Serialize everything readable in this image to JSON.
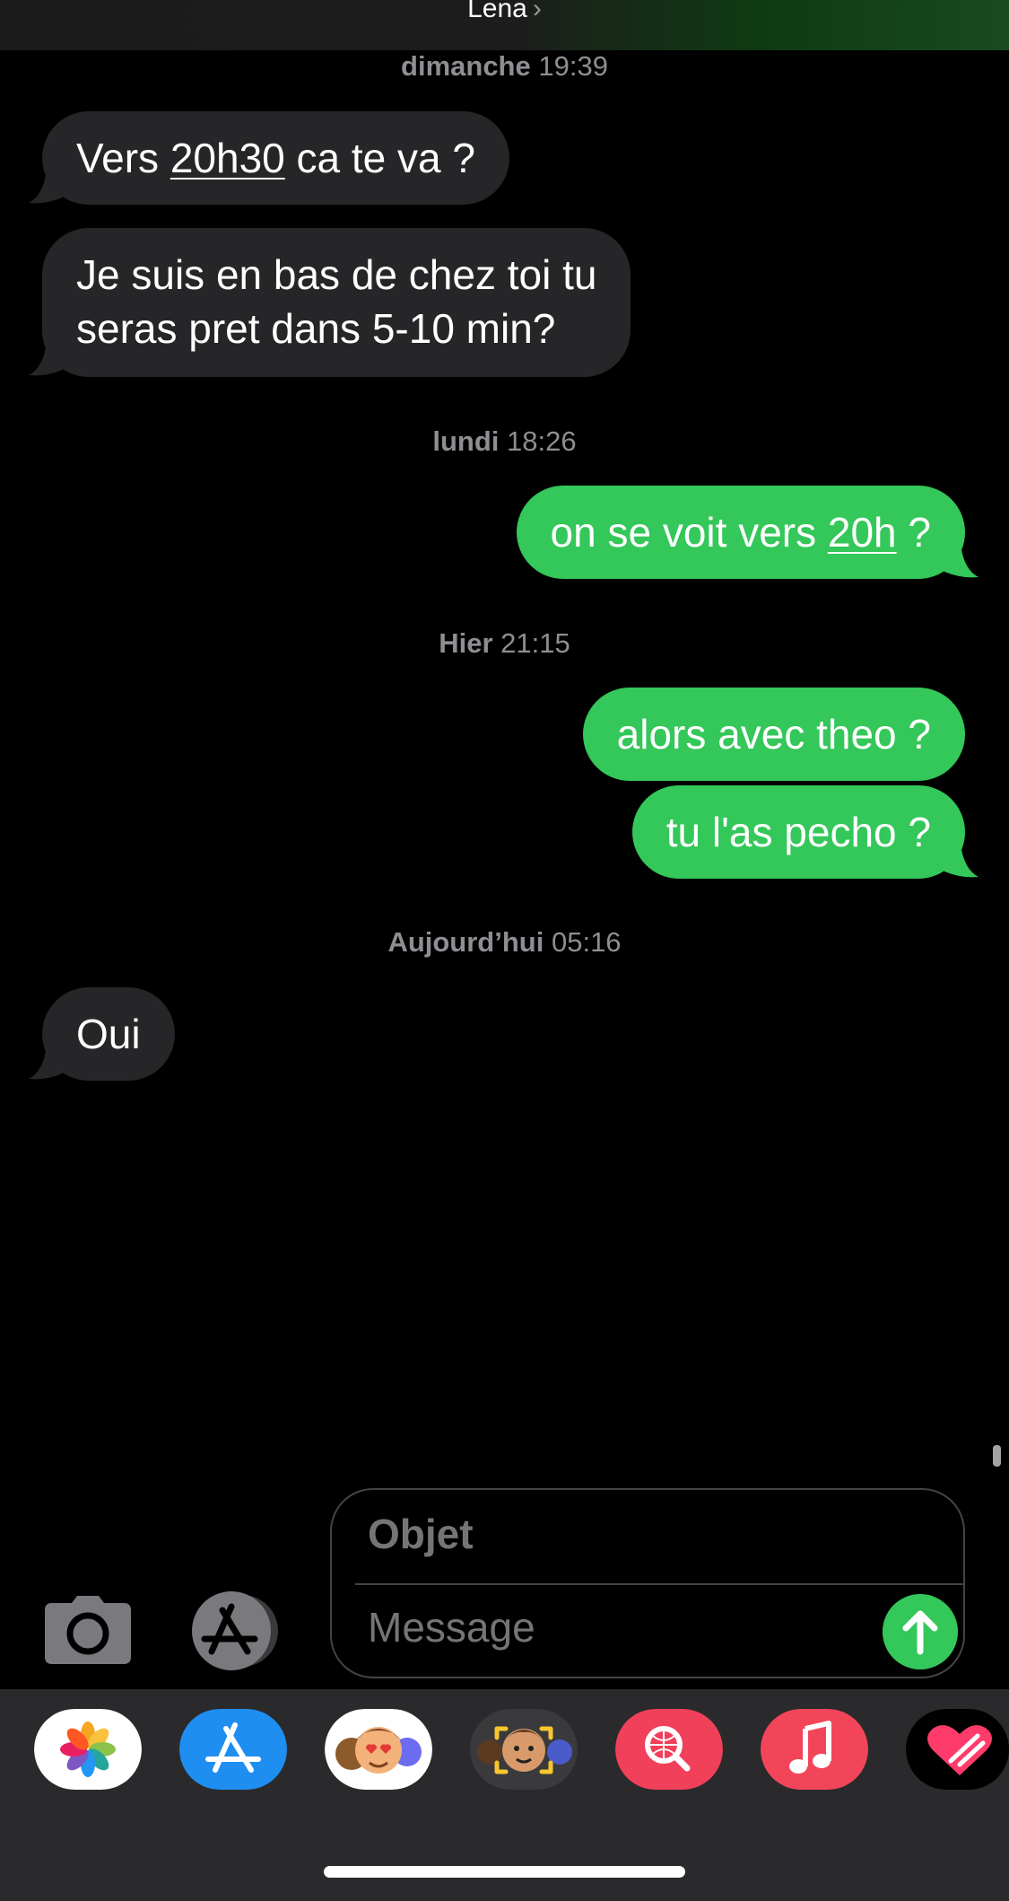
{
  "header": {
    "contact_name": "Lena",
    "chevron": "›"
  },
  "conversation": {
    "groups": [
      {
        "day": "dimanche",
        "time": "19:39"
      },
      {
        "day": "lundi",
        "time": "18:26"
      },
      {
        "day": "Hier",
        "time": "21:15"
      },
      {
        "day": "Aujourd’hui",
        "time": "05:16"
      }
    ],
    "messages": [
      {
        "direction": "in",
        "before": "Vers ",
        "link": "20h30",
        "after": " ca te va ?"
      },
      {
        "direction": "in",
        "line1": "Je suis en bas de chez toi tu",
        "line2": "seras pret dans 5-10 min?"
      },
      {
        "direction": "out",
        "before": "on se voit vers ",
        "link": "20h",
        "after": " ?"
      },
      {
        "direction": "out",
        "text": "alors avec theo ?"
      },
      {
        "direction": "out",
        "text": "tu l'as pecho ?"
      },
      {
        "direction": "in",
        "text": "Oui"
      }
    ]
  },
  "compose": {
    "subject_placeholder": "Objet",
    "message_placeholder": "Message"
  },
  "app_drawer": {
    "apps": [
      {
        "icon": "photos-icon"
      },
      {
        "icon": "app-store-icon"
      },
      {
        "icon": "animoji-stickers-icon"
      },
      {
        "icon": "memoji-icon"
      },
      {
        "icon": "image-search-icon"
      },
      {
        "icon": "music-icon"
      },
      {
        "icon": "digital-touch-icon"
      }
    ]
  },
  "colors": {
    "background": "#000000",
    "incoming_bubble": "#262628",
    "outgoing_bubble": "#34c759",
    "timestamp": "#8e8e93",
    "drawer": "#2a2a2c"
  }
}
